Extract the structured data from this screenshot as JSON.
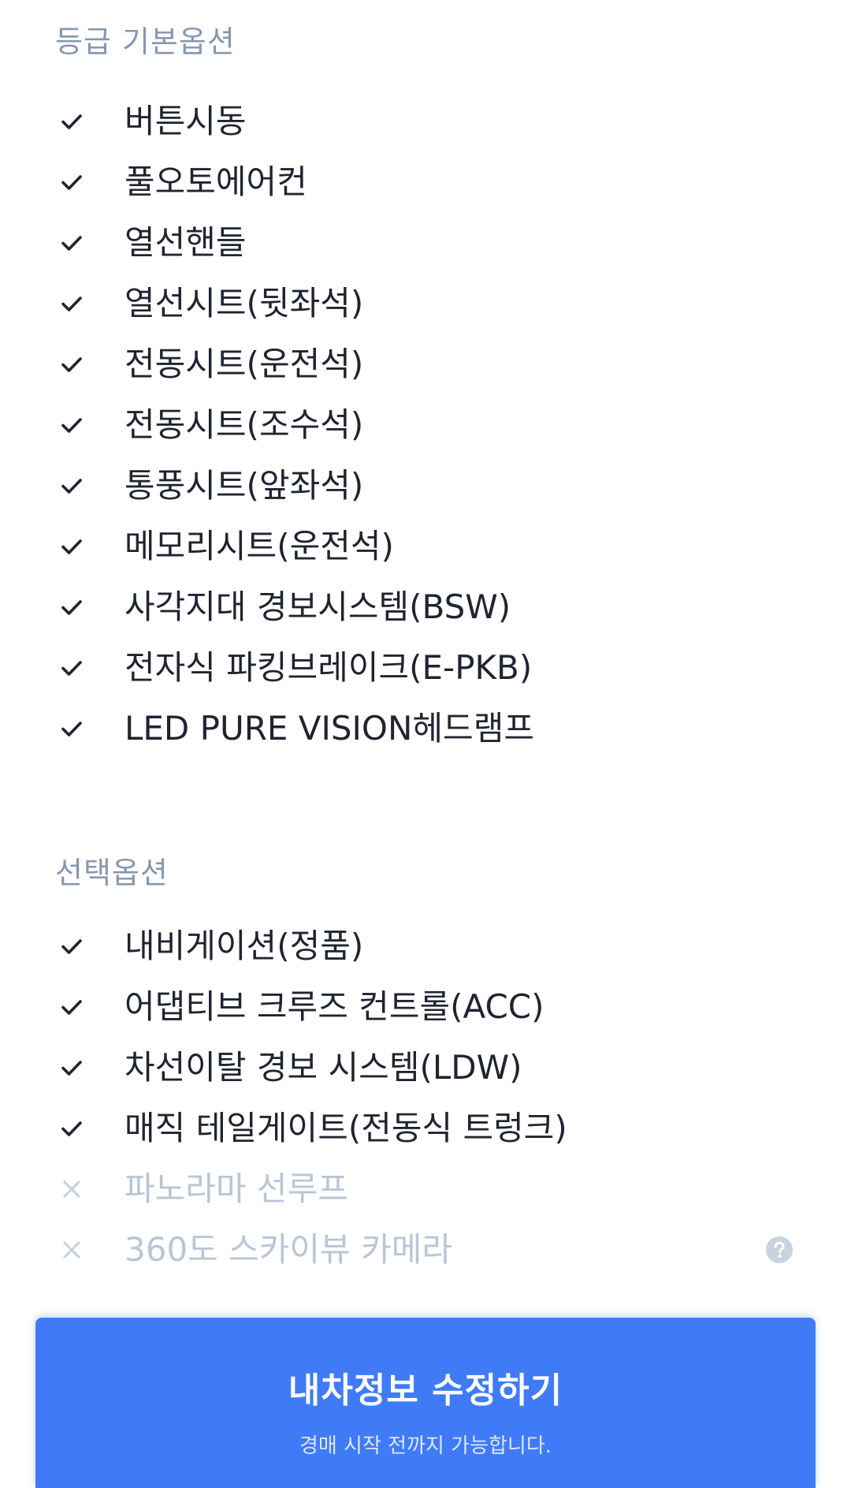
{
  "basic_options": {
    "title": "등급 기본옵션",
    "items": [
      {
        "label": "버튼시동",
        "included": true
      },
      {
        "label": "풀오토에어컨",
        "included": true
      },
      {
        "label": "열선핸들",
        "included": true
      },
      {
        "label": "열선시트(뒷좌석)",
        "included": true
      },
      {
        "label": "전동시트(운전석)",
        "included": true
      },
      {
        "label": "전동시트(조수석)",
        "included": true
      },
      {
        "label": "통풍시트(앞좌석)",
        "included": true
      },
      {
        "label": "메모리시트(운전석)",
        "included": true
      },
      {
        "label": "사각지대 경보시스템(BSW)",
        "included": true
      },
      {
        "label": "전자식 파킹브레이크(E-PKB)",
        "included": true
      },
      {
        "label": "LED PURE VISION헤드램프",
        "included": true
      }
    ]
  },
  "selected_options": {
    "title": "선택옵션",
    "items": [
      {
        "label": "내비게이션(정품)",
        "included": true
      },
      {
        "label": "어댑티브 크루즈 컨트롤(ACC)",
        "included": true
      },
      {
        "label": "차선이탈 경보 시스템(LDW)",
        "included": true
      },
      {
        "label": "매직 테일게이트(전동식 트렁크)",
        "included": true
      },
      {
        "label": "파노라마 선루프",
        "included": false
      },
      {
        "label": "360도 스카이뷰 카메라",
        "included": false,
        "has_help": true
      }
    ]
  },
  "icons": {
    "included": "check-icon",
    "excluded": "x-icon",
    "help": "question-icon"
  },
  "colors": {
    "section_title": "#8797b0",
    "included_text": "#1f2430",
    "excluded_text": "#b8c6d6",
    "cta_background": "#3f7bf7"
  },
  "cta": {
    "title": "내차정보 수정하기",
    "subtitle": "경매 시작 전까지 가능합니다."
  }
}
